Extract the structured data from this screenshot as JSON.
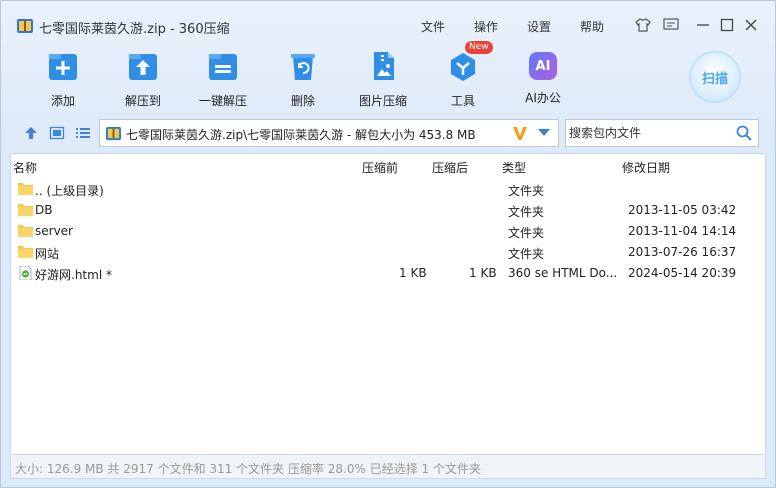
{
  "window": {
    "title": "七零国际莱茵久游.zip - 360压缩",
    "menu": [
      "文件",
      "操作",
      "设置",
      "帮助"
    ]
  },
  "toolbar": {
    "items": [
      {
        "label": "添加",
        "icon": "add-icon"
      },
      {
        "label": "解压到",
        "icon": "extract-to-icon"
      },
      {
        "label": "一键解压",
        "icon": "one-click-extract-icon"
      },
      {
        "label": "删除",
        "icon": "recycle-bin-icon"
      },
      {
        "label": "图片压缩",
        "icon": "image-compress-icon"
      },
      {
        "label": "工具",
        "icon": "tools-icon",
        "badge": "New"
      },
      {
        "label": "AI办公",
        "icon": "ai-icon",
        "icon_text": "AI"
      }
    ],
    "scan_label": "扫描"
  },
  "address": {
    "path": "七零国际莱茵久游.zip\\七零国际莱茵久游 - 解包大小为 453.8 MB"
  },
  "search": {
    "placeholder": "搜索包内文件"
  },
  "columns": [
    "名称",
    "压缩前",
    "压缩后",
    "类型",
    "修改日期"
  ],
  "rows": [
    {
      "name": ".. (上级目录)",
      "before": "",
      "after": "",
      "type": "文件夹",
      "date": "",
      "kind": "folder"
    },
    {
      "name": "DB",
      "before": "",
      "after": "",
      "type": "文件夹",
      "date": "2013-11-05 03:42",
      "kind": "folder"
    },
    {
      "name": "server",
      "before": "",
      "after": "",
      "type": "文件夹",
      "date": "2013-11-04 14:14",
      "kind": "folder"
    },
    {
      "name": "网站",
      "before": "",
      "after": "",
      "type": "文件夹",
      "date": "2013-07-26 16:37",
      "kind": "folder"
    },
    {
      "name": "好游网.html *",
      "before": "1 KB",
      "after": "1 KB",
      "type": "360 se HTML Do...",
      "date": "2024-05-14 20:39",
      "kind": "html"
    }
  ],
  "status": "大小: 126.9 MB 共 2917 个文件和 311 个文件夹 压缩率 28.0% 已经选择 1 个文件夹",
  "colors": {
    "accent": "#2f8fe6",
    "folder": "#f7c64a",
    "badge": "#e8433a"
  }
}
